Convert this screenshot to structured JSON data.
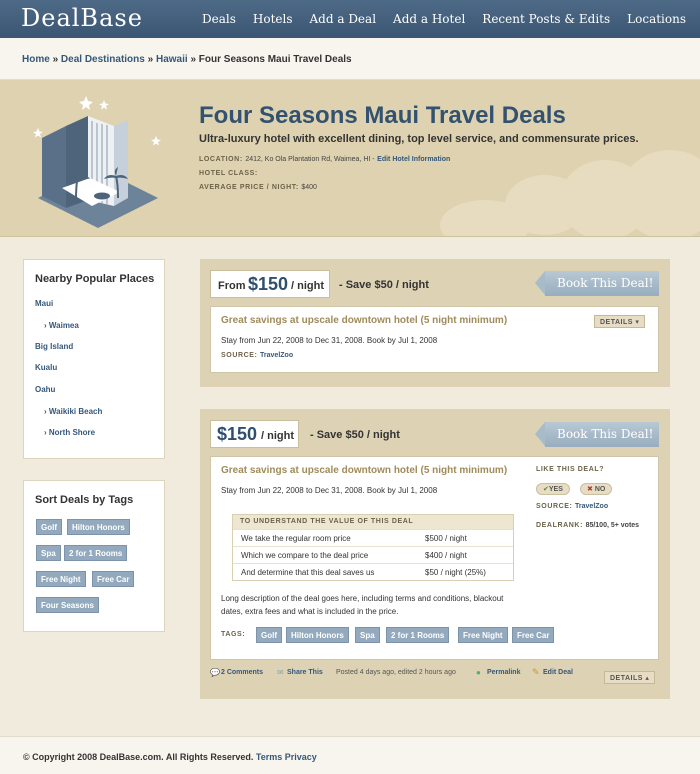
{
  "header": {
    "logo": "DealBase",
    "nav": [
      "Deals",
      "Hotels",
      "Add a Deal",
      "Add a Hotel",
      "Recent Posts & Edits",
      "Locations"
    ]
  },
  "breadcrumb": {
    "items": [
      "Home",
      "Deal Destinations",
      "Hawaii"
    ],
    "sep": "»",
    "current": "Four Seasons Maui Travel Deals"
  },
  "hotel": {
    "title": "Four Seasons Maui Travel Deals",
    "subtitle": "Ultra-luxury hotel with excellent dining, top level service, and commensurate prices.",
    "location_label": "LOCATION:",
    "location": "2412, Ko Ola Plantation Rd, Waimea, HI -",
    "edit_link": "Edit Hotel Information",
    "class_label": "HOTEL CLASS:",
    "price_label": "AVERAGE PRICE / NIGHT:",
    "price": "$400"
  },
  "sidebar": {
    "places_title": "Nearby Popular Places",
    "places": [
      "Maui",
      "› Waimea",
      "Big Island",
      "Kualu",
      "Oahu",
      "› Waikiki Beach",
      "› North Shore"
    ],
    "tags_title": "Sort Deals by Tags",
    "tags": [
      "Golf",
      "Hilton Honors",
      "Spa",
      "2 for 1 Rooms",
      "Free Night",
      "Free Car",
      "Four Seasons"
    ]
  },
  "deal1": {
    "from": "From",
    "price": "$150",
    "per": "/ night",
    "save": "- Save $50 / night",
    "book": "Book This Deal!",
    "title": "Great savings at upscale downtown hotel (5 night minimum)",
    "details": "DETAILS",
    "stay": "Stay from Jun 22, 2008 to Dec 31, 2008. Book by Jul 1, 2008",
    "source_label": "SOURCE:",
    "source": "TravelZoo"
  },
  "deal2": {
    "price": "$150",
    "per": "/ night",
    "save": "- Save $50 / night",
    "book": "Book This Deal!",
    "title": "Great savings at upscale downtown hotel (5 night minimum)",
    "stay": "Stay from Jun 22, 2008 to Dec 31, 2008. Book by Jul 1, 2008",
    "value_header": "TO UNDERSTAND THE VALUE OF THIS DEAL",
    "value_rows": [
      {
        "label": "We take the regular room price",
        "value": "$500 / night"
      },
      {
        "label": "Which we compare to the deal price",
        "value": "$400 / night"
      },
      {
        "label": "And determine that this deal saves us",
        "value": "$50 / night (25%)"
      }
    ],
    "description": "Long description of the deal goes here, including terms and conditions, blackout dates, extra fees and what is included in the price.",
    "tags_label": "TAGS:",
    "tags": [
      "Golf",
      "Hilton Honors",
      "Spa",
      "2 for 1 Rooms",
      "Free Night",
      "Free Car"
    ],
    "like_label": "LIKE THIS DEAL?",
    "yes": "YES",
    "no": "NO",
    "source_label": "SOURCE:",
    "source": "TravelZoo",
    "rank_label": "DEALRANK:",
    "rank": "85/100, 5+ votes",
    "comments": "2 Comments",
    "share": "Share This",
    "posted": "Posted 4 days ago, edited 2 hours ago",
    "permalink": "Permalink",
    "edit": "Edit Deal",
    "details": "DETAILS"
  },
  "footer": {
    "copyright": "© Copyright 2008 DealBase.com. All Rights Reserved.",
    "terms": "Terms",
    "privacy": "Privacy"
  }
}
